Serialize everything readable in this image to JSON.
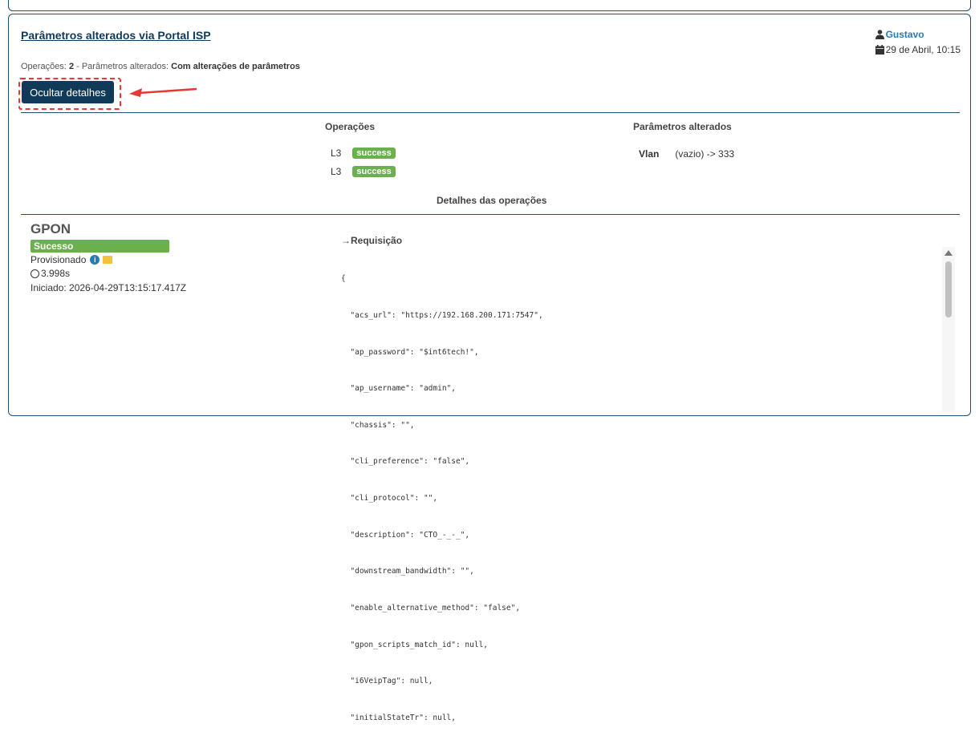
{
  "card": {
    "title": "Parâmetros alterados via Portal ISP",
    "user": "Gustavo",
    "date": "29 de Abril, 10:15",
    "summary_ops_label": "Operações:",
    "summary_ops_count": "2",
    "summary_sep": " - ",
    "summary_params_label": "Parâmetros alterados:",
    "summary_params_value": "Com alterações de parâmetros",
    "toggle_button": "Ocultar detalhes"
  },
  "operations": {
    "header": "Operações",
    "rows": [
      {
        "name": "L3",
        "status": "success"
      },
      {
        "name": "L3",
        "status": "success"
      }
    ]
  },
  "params": {
    "header": "Parâmetros alterados",
    "rows": [
      {
        "name": "Vlan",
        "change": "(vazio) -> 333"
      }
    ]
  },
  "details_header": "Detalhes das operações",
  "gpon": {
    "title": "GPON",
    "status": "Sucesso",
    "state": "Provisionado",
    "duration": "3.998s",
    "started": "Iniciado: 2026-04-29T13:15:17.417Z"
  },
  "request": {
    "title": "→Requisição",
    "lines": [
      "{",
      "  \"acs_url\": \"https://192.168.200.171:7547\",",
      "  \"ap_password\": \"$int6tech!\",",
      "  \"ap_username\": \"admin\",",
      "  \"chassis\": \"\",",
      "  \"cli_preference\": \"false\",",
      "  \"cli_protocol\": \"\",",
      "  \"description\": \"CTO_-_-_\",",
      "  \"downstream_bandwidth\": \"\",",
      "  \"enable_alternative_method\": \"false\",",
      "  \"gpon_scripts_match_id\": null,",
      "  \"i6VeipTag\": null,",
      "  \"initialStateTr\": null,"
    ]
  },
  "colors": {
    "primary": "#103a57",
    "success": "#6ab04c",
    "link": "#2a7ab0",
    "highlight": "#e53935"
  }
}
